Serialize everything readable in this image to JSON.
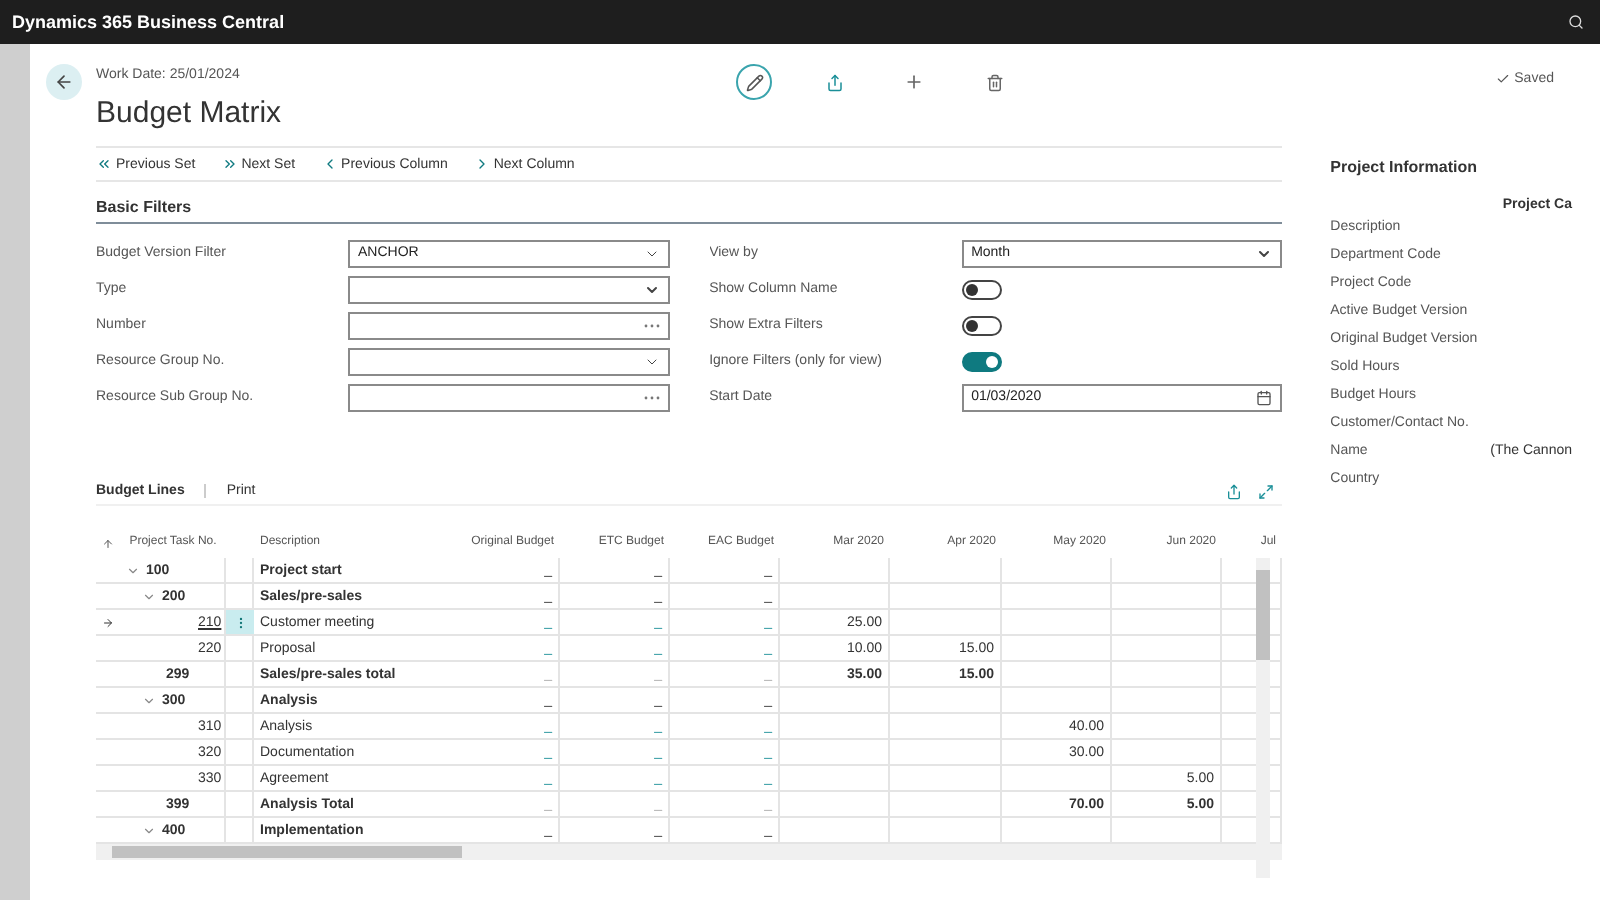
{
  "app_bar": {
    "title": "Dynamics 365 Business Central"
  },
  "header": {
    "work_date": "Work Date: 25/01/2024",
    "title": "Budget Matrix",
    "status": "Saved"
  },
  "actions": [
    {
      "label": "Previous Set",
      "kind": "prev-set"
    },
    {
      "label": "Next Set",
      "kind": "next-set"
    },
    {
      "label": "Previous Column",
      "kind": "prev"
    },
    {
      "label": "Next Column",
      "kind": "next"
    }
  ],
  "filters": {
    "title": "Basic Filters",
    "left": [
      {
        "label": "Budget Version Filter",
        "kind": "dropdown",
        "value": "ANCHOR"
      },
      {
        "label": "Type",
        "kind": "select"
      },
      {
        "label": "Number",
        "kind": "lookup"
      },
      {
        "label": "Resource Group No.",
        "kind": "dropdown"
      },
      {
        "label": "Resource Sub Group No.",
        "kind": "lookup"
      }
    ],
    "right": [
      {
        "label": "View by",
        "kind": "select",
        "value": "Month"
      },
      {
        "label": "Show Column Name",
        "kind": "toggle",
        "on": false
      },
      {
        "label": "Show Extra Filters",
        "kind": "toggle",
        "on": false
      },
      {
        "label": "Ignore Filters (only for view)",
        "kind": "toggle",
        "on": true
      },
      {
        "label": "Start Date",
        "kind": "date",
        "value": "01/03/2020"
      }
    ]
  },
  "lines": {
    "title": "Budget Lines",
    "actions": [
      "Print"
    ],
    "columns": [
      "Project Task No.",
      "Description",
      "Original Budget",
      "ETC Budget",
      "EAC Budget",
      "Mar 2020",
      "Apr 2020",
      "May 2020",
      "Jun 2020",
      "Jul"
    ],
    "rows": [
      {
        "no": "100",
        "description": "Project start",
        "kind": "group",
        "expanded": true,
        "selected": false,
        "cells": {
          "original_budget": "_",
          "etc_budget": "_",
          "eac_budget": "_"
        },
        "children": [
          {
            "no": "200",
            "description": "Sales/pre-sales",
            "kind": "group",
            "expanded": true,
            "selected": false,
            "cells": {
              "original_budget": "_",
              "etc_budget": "_",
              "eac_budget": "_"
            },
            "children": [
              {
                "no": "210",
                "description": "Customer meeting",
                "kind": "line",
                "selected": true,
                "cells": {
                  "original_budget": "_",
                  "etc_budget": "_",
                  "eac_budget": "_",
                  "mar_2020": "25.00"
                }
              },
              {
                "no": "220",
                "description": "Proposal",
                "kind": "line",
                "selected": false,
                "cells": {
                  "original_budget": "_",
                  "etc_budget": "_",
                  "eac_budget": "_",
                  "mar_2020": "10.00",
                  "apr_2020": "15.00"
                }
              }
            ]
          },
          {
            "no": "299",
            "description": "Sales/pre-sales total",
            "kind": "total",
            "selected": false,
            "cells": {
              "original_budget": "_",
              "etc_budget": "_",
              "eac_budget": "_",
              "mar_2020": "35.00",
              "apr_2020": "15.00"
            }
          },
          {
            "no": "300",
            "description": "Analysis",
            "kind": "group",
            "expanded": true,
            "selected": false,
            "cells": {
              "original_budget": "_",
              "etc_budget": "_",
              "eac_budget": "_"
            },
            "children": [
              {
                "no": "310",
                "description": "Analysis",
                "kind": "line",
                "selected": false,
                "cells": {
                  "original_budget": "_",
                  "etc_budget": "_",
                  "eac_budget": "_",
                  "may_2020": "40.00"
                }
              },
              {
                "no": "320",
                "description": "Documentation",
                "kind": "line",
                "selected": false,
                "cells": {
                  "original_budget": "_",
                  "etc_budget": "_",
                  "eac_budget": "_",
                  "may_2020": "30.00"
                }
              },
              {
                "no": "330",
                "description": "Agreement",
                "kind": "line",
                "selected": false,
                "cells": {
                  "original_budget": "_",
                  "etc_budget": "_",
                  "eac_budget": "_",
                  "jun_2020": "5.00"
                }
              }
            ]
          },
          {
            "no": "399",
            "description": "Analysis Total",
            "kind": "total",
            "selected": false,
            "cells": {
              "original_budget": "_",
              "etc_budget": "_",
              "eac_budget": "_",
              "may_2020": "70.00",
              "jun_2020": "5.00"
            }
          },
          {
            "no": "400",
            "description": "Implementation",
            "kind": "group",
            "expanded": true,
            "selected": false,
            "cells": {
              "original_budget": "_",
              "etc_budget": "_",
              "eac_budget": "_"
            }
          }
        ]
      }
    ]
  },
  "info": {
    "title": "Project Information",
    "column_1": "Project Ca",
    "fields": [
      {
        "label": "Description"
      },
      {
        "label": "Department Code"
      },
      {
        "label": "Project Code"
      },
      {
        "label": "Active Budget Version"
      },
      {
        "label": "Original Budget Version"
      },
      {
        "label": "Sold Hours"
      },
      {
        "label": "Budget Hours"
      },
      {
        "label": "Customer/Contact No."
      },
      {
        "label": "Name",
        "value": "(The Cannon"
      },
      {
        "label": "Country"
      }
    ]
  }
}
